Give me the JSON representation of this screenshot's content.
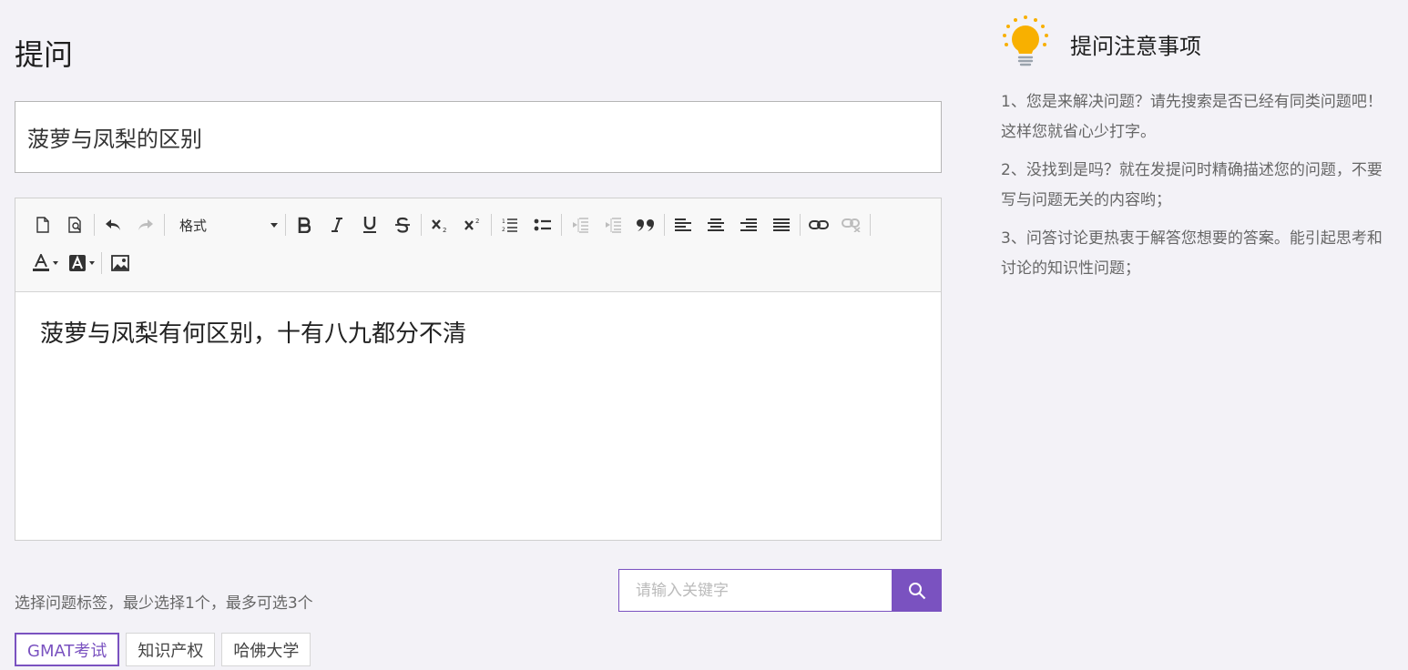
{
  "page": {
    "title": "提问"
  },
  "question": {
    "title_value": "菠萝与凤梨的区别"
  },
  "editor": {
    "format_label": "格式",
    "content": "菠萝与凤梨有何区别，十有八九都分不清"
  },
  "tags_section": {
    "hint": "选择问题标签，最少选择1个，最多可选3个",
    "search_placeholder": "请输入关键字",
    "tags": [
      {
        "label": "GMAT考试",
        "selected": true
      },
      {
        "label": "知识产权",
        "selected": false
      },
      {
        "label": "哈佛大学",
        "selected": false
      }
    ]
  },
  "sidebar": {
    "title": "提问注意事项",
    "notes": [
      "1、您是来解决问题？请先搜索是否已经有同类问题吧！这样您就省心少打字。",
      "2、没找到是吗？就在发提问时精确描述您的问题，不要写与问题无关的内容哟；",
      "3、问答讨论更热衷于解答您想要的答案。能引起思考和讨论的知识性问题；"
    ]
  },
  "colors": {
    "accent": "#7a52c0",
    "bulb": "#f8b000",
    "background": "#f3f2f7"
  },
  "icons": [
    "new-page-icon",
    "preview-icon",
    "undo-icon",
    "redo-icon",
    "bold-icon",
    "italic-icon",
    "underline-icon",
    "strikethrough-icon",
    "subscript-icon",
    "superscript-icon",
    "numbered-list-icon",
    "bulleted-list-icon",
    "outdent-icon",
    "indent-icon",
    "blockquote-icon",
    "align-left-icon",
    "align-center-icon",
    "align-right-icon",
    "align-justify-icon",
    "link-icon",
    "unlink-icon",
    "text-color-icon",
    "background-color-icon",
    "image-icon",
    "search-icon",
    "lightbulb-icon"
  ]
}
